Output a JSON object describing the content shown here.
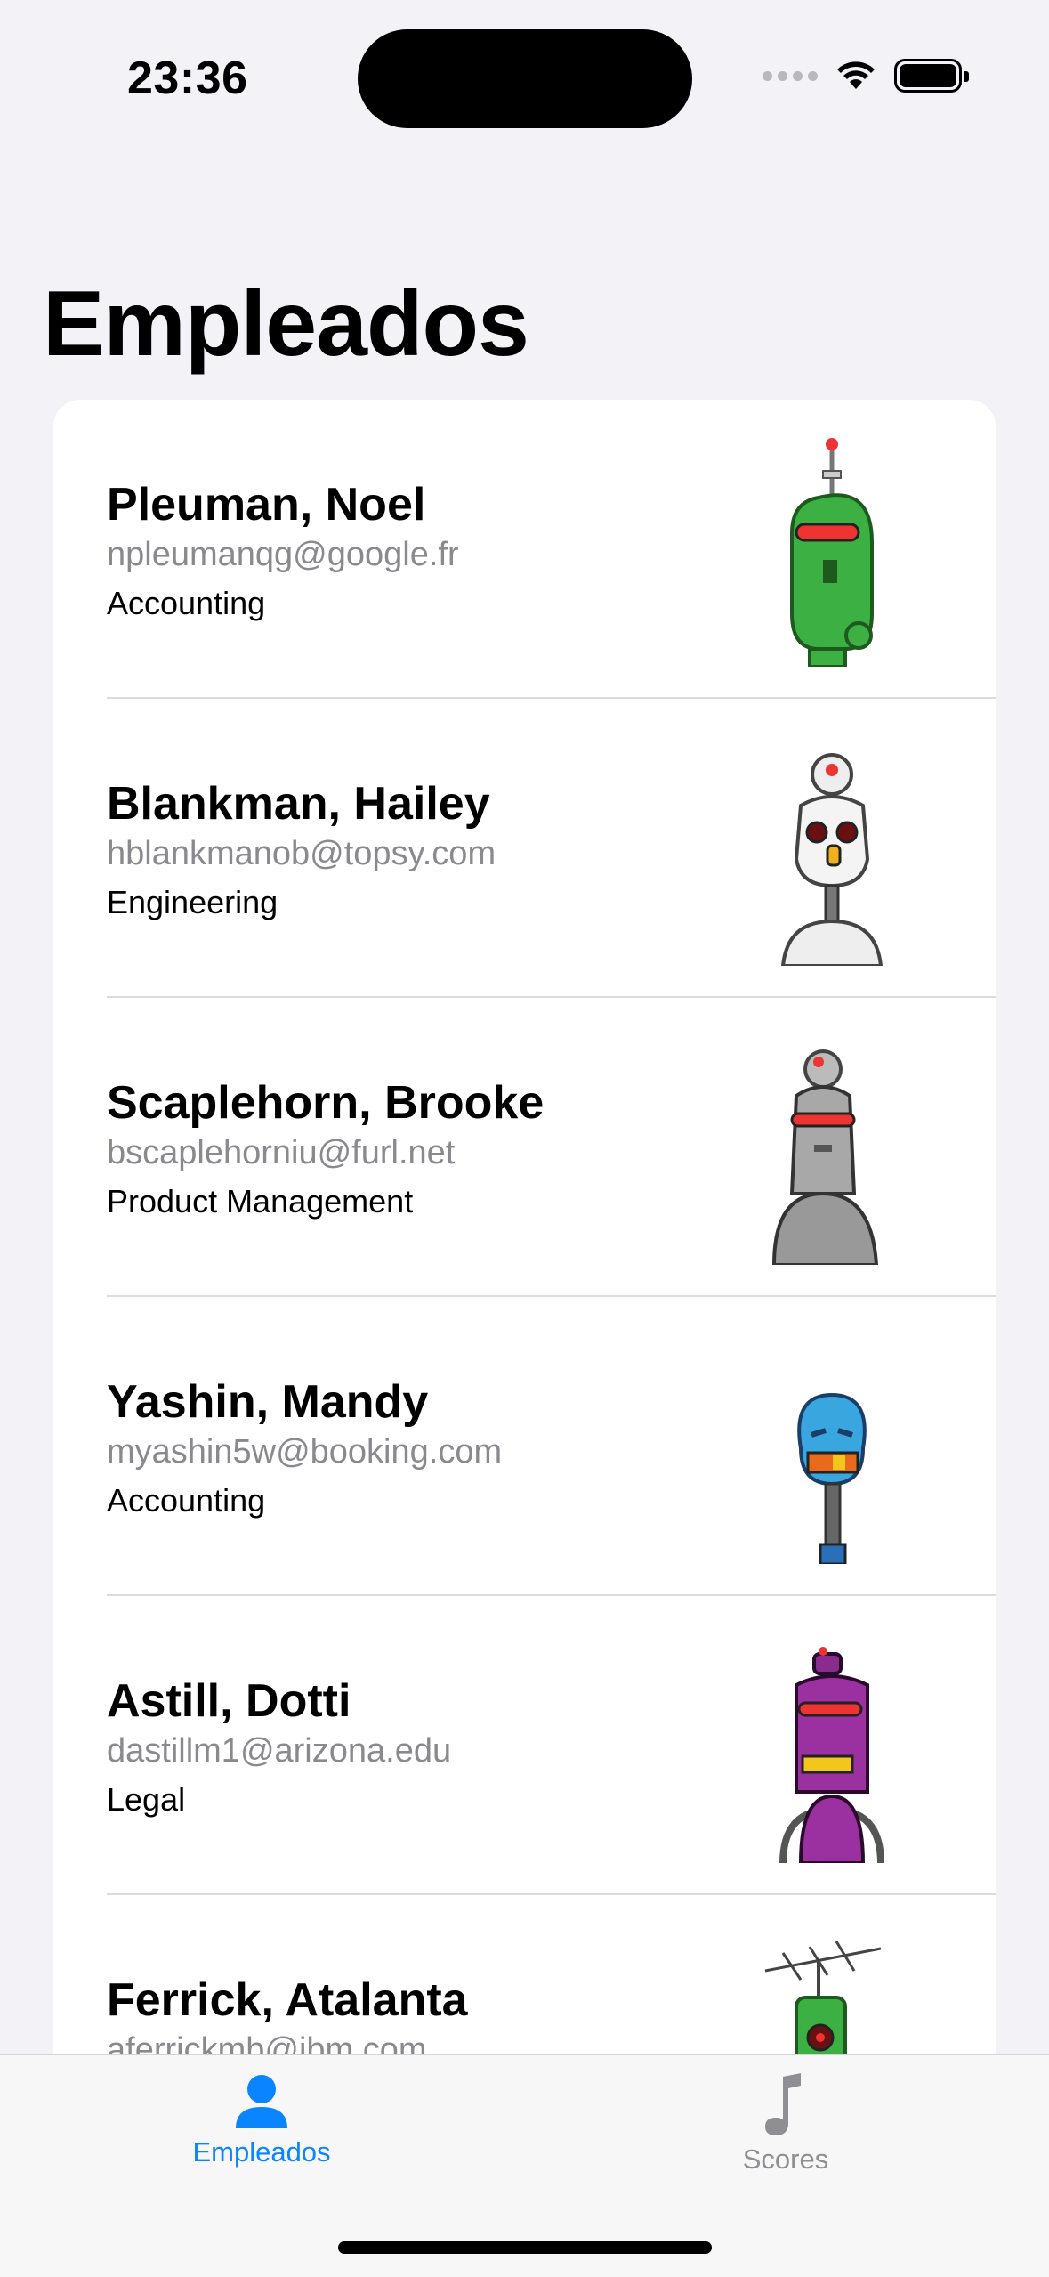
{
  "status_bar": {
    "time": "23:36"
  },
  "page": {
    "title": "Empleados"
  },
  "employees": [
    {
      "name": "Pleuman, Noel",
      "email": "npleumanqg@google.fr",
      "department": "Accounting",
      "avatar": "green-robot-icon"
    },
    {
      "name": "Blankman, Hailey",
      "email": "hblankmanob@topsy.com",
      "department": "Engineering",
      "avatar": "white-robot-icon"
    },
    {
      "name": "Scaplehorn, Brooke",
      "email": "bscaplehorniu@furl.net",
      "department": "Product Management",
      "avatar": "gray-robot-icon"
    },
    {
      "name": "Yashin, Mandy",
      "email": "myashin5w@booking.com",
      "department": "Accounting",
      "avatar": "blue-robot-icon"
    },
    {
      "name": "Astill, Dotti",
      "email": "dastillm1@arizona.edu",
      "department": "Legal",
      "avatar": "purple-robot-icon"
    },
    {
      "name": "Ferrick, Atalanta",
      "email": "aferrickmb@ibm.com",
      "department": "",
      "avatar": "antenna-robot-icon"
    }
  ],
  "tabs": [
    {
      "label": "Empleados",
      "icon": "person-icon",
      "selected": true
    },
    {
      "label": "Scores",
      "icon": "music-note-icon",
      "selected": false
    }
  ],
  "colors": {
    "accent": "#0A84FF",
    "background": "#F2F2F7"
  }
}
